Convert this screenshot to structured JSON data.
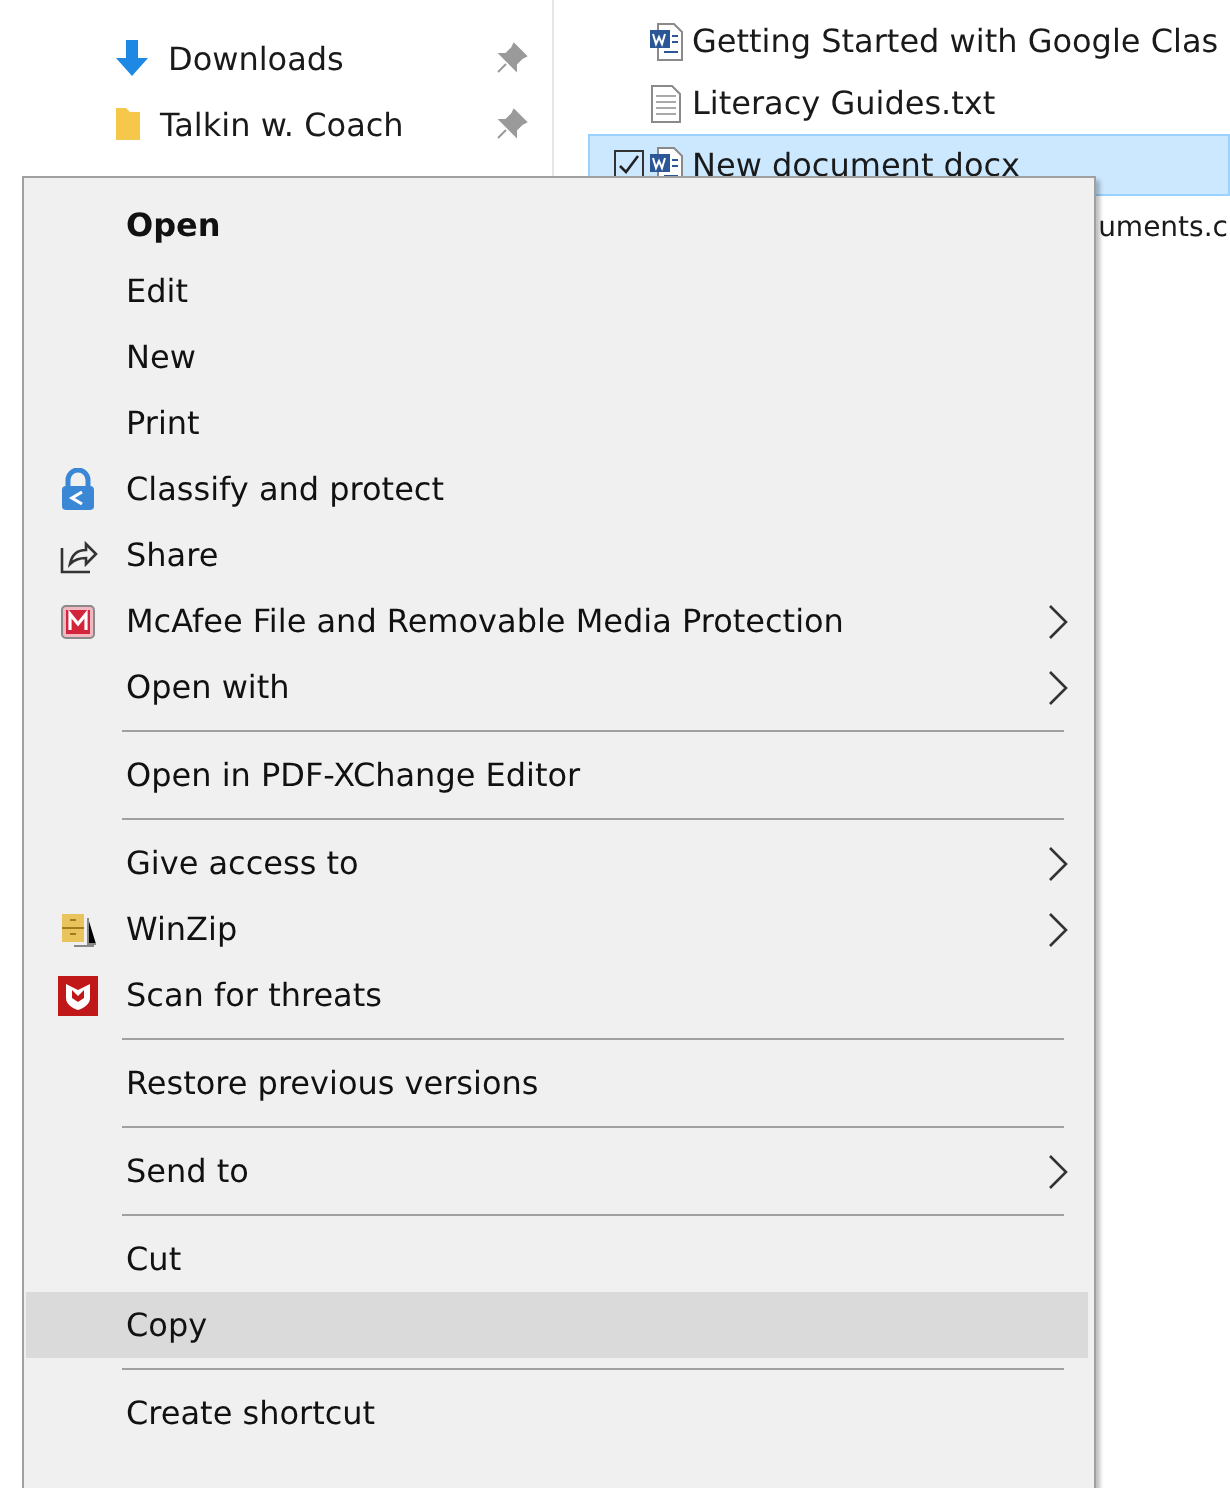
{
  "navigation": {
    "items": [
      {
        "label": "Downloads",
        "kind": "download",
        "pinned": true
      },
      {
        "label": "Talkin w. Coach",
        "kind": "folder",
        "pinned": true
      }
    ]
  },
  "files": {
    "rows": [
      {
        "name": "Getting Started with Google Clas",
        "kind": "word",
        "selected": false,
        "checked": false
      },
      {
        "name": "Literacy Guides.txt",
        "kind": "text",
        "selected": false,
        "checked": false
      },
      {
        "name": "New document docx",
        "kind": "word",
        "selected": true,
        "checked": true
      },
      {
        "name": "uments.c",
        "kind": "partial",
        "selected": false,
        "checked": false
      }
    ]
  },
  "context_menu": {
    "items": [
      {
        "kind": "item",
        "label": "Open",
        "default": true,
        "submenu": false,
        "selected": false
      },
      {
        "kind": "item",
        "label": "Edit",
        "default": false,
        "submenu": false,
        "selected": false
      },
      {
        "kind": "item",
        "label": "New",
        "default": false,
        "submenu": false,
        "selected": false
      },
      {
        "kind": "item",
        "label": "Print",
        "default": false,
        "submenu": false,
        "selected": false
      },
      {
        "kind": "item",
        "label": "Classify and protect",
        "default": false,
        "submenu": false,
        "selected": false
      },
      {
        "kind": "item",
        "label": "Share",
        "default": false,
        "submenu": false,
        "selected": false
      },
      {
        "kind": "item",
        "label": "McAfee File and Removable Media Protection",
        "default": false,
        "submenu": true,
        "selected": false
      },
      {
        "kind": "item",
        "label": "Open with",
        "default": false,
        "submenu": true,
        "selected": false
      },
      {
        "kind": "separator"
      },
      {
        "kind": "item",
        "label": "Open in PDF-XChange Editor",
        "default": false,
        "submenu": false,
        "selected": false
      },
      {
        "kind": "separator"
      },
      {
        "kind": "item",
        "label": "Give access to",
        "default": false,
        "submenu": true,
        "selected": false
      },
      {
        "kind": "item",
        "label": "WinZip",
        "default": false,
        "submenu": true,
        "selected": false
      },
      {
        "kind": "item",
        "label": "Scan for threats",
        "default": false,
        "submenu": false,
        "selected": false
      },
      {
        "kind": "separator"
      },
      {
        "kind": "item",
        "label": "Restore previous versions",
        "default": false,
        "submenu": false,
        "selected": false
      },
      {
        "kind": "separator"
      },
      {
        "kind": "item",
        "label": "Send to",
        "default": false,
        "submenu": true,
        "selected": false
      },
      {
        "kind": "separator"
      },
      {
        "kind": "item",
        "label": "Cut",
        "default": false,
        "submenu": false,
        "selected": false
      },
      {
        "kind": "item",
        "label": "Copy",
        "default": false,
        "submenu": false,
        "selected": true
      },
      {
        "kind": "separator"
      },
      {
        "kind": "item",
        "label": "Create shortcut",
        "default": false,
        "submenu": false,
        "selected": false
      }
    ]
  }
}
